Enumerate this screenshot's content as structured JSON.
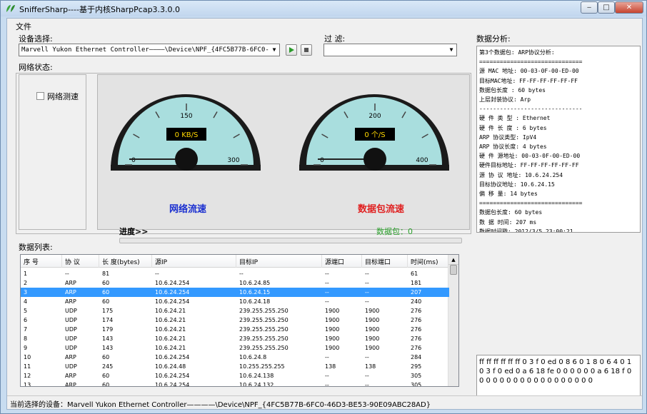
{
  "window": {
    "title": "SnifferSharp----基于内核SharpPcap3.3.0.0"
  },
  "menu": {
    "file": "文件"
  },
  "device": {
    "label": "设备选择:",
    "value": "Marvell Yukon Ethernet Controller————\\Device\\NPF_{4FC5B77B-6FC0-46"
  },
  "filter": {
    "label": "过 滤:",
    "value": ""
  },
  "network_status": {
    "label": "网络状态:",
    "speed_test_label": "网络测速",
    "speed_test_checked": false
  },
  "gauge_flow": {
    "caption": "网络流速",
    "readout": "0 KB/S",
    "ticks": [
      "0",
      "150",
      "300"
    ],
    "value": 0,
    "max": 300,
    "caption_color": "#1a2fd0"
  },
  "gauge_packets": {
    "caption": "数据包流速",
    "readout": "0 个/S",
    "ticks": [
      "0",
      "200",
      "400"
    ],
    "value": 0,
    "max": 400,
    "caption_color": "#e02020"
  },
  "progress": {
    "label": "进度>>",
    "packets_label": "数据包：0",
    "packets_color": "#2ca02c",
    "fraction": 0
  },
  "analysis": {
    "label": "数据分析:",
    "lines": [
      "第3个数据包: ARP协议分析:",
      "==============================",
      "源 MAC 地址: 00-03-0F-00-ED-00",
      "目标MAC地址: FF-FF-FF-FF-FF-FF",
      "数据包长度 : 60 bytes",
      "上层封装协议: Arp",
      "------------------------------",
      "硬 件 类 型 : Ethernet",
      "硬 件 长 度 : 6 bytes",
      "ARP 协议类型: IpV4",
      "ARP 协议长度: 4 bytes",
      "硬 件 源地址: 00-03-0F-00-ED-00",
      "硬件目标地址: FF-FF-FF-FF-FF-FF",
      "源 协 议 地址: 10.6.24.254",
      "目标协议地址: 10.6.24.15",
      "偏    移    量: 14 bytes",
      "==============================",
      "数据包长度: 60 bytes",
      "数 据 时间: 207 ms",
      "数据时间戳: 2012/3/5 23:00:21"
    ],
    "hex": "ff ff ff ff ff ff 0 3 f 0 ed 0 8 6 0 1 8 0 6 4 0 1 0 3 f 0 ed 0 a 6 18 fe 0 0 0 0 0 0 a 6 18 f 0 0 0 0 0 0 0 0 0 0 0 0 0 0 0 0 0 0"
  },
  "table": {
    "label": "数据列表:",
    "columns": [
      "序 号",
      "协 议",
      "长 度(bytes)",
      "源IP",
      "目标IP",
      "源端口",
      "目标端口",
      "时间(ms)"
    ],
    "rows": [
      [
        "1",
        "--",
        "81",
        "--",
        "--",
        "--",
        "--",
        "61"
      ],
      [
        "2",
        "ARP",
        "60",
        "10.6.24.254",
        "10.6.24.85",
        "--",
        "--",
        "181"
      ],
      [
        "3",
        "ARP",
        "60",
        "10.6.24.254",
        "10.6.24.15",
        "--",
        "--",
        "207"
      ],
      [
        "4",
        "ARP",
        "60",
        "10.6.24.254",
        "10.6.24.18",
        "--",
        "--",
        "240"
      ],
      [
        "5",
        "UDP",
        "175",
        "10.6.24.21",
        "239.255.255.250",
        "1900",
        "1900",
        "276"
      ],
      [
        "6",
        "UDP",
        "174",
        "10.6.24.21",
        "239.255.255.250",
        "1900",
        "1900",
        "276"
      ],
      [
        "7",
        "UDP",
        "179",
        "10.6.24.21",
        "239.255.255.250",
        "1900",
        "1900",
        "276"
      ],
      [
        "8",
        "UDP",
        "143",
        "10.6.24.21",
        "239.255.255.250",
        "1900",
        "1900",
        "276"
      ],
      [
        "9",
        "UDP",
        "143",
        "10.6.24.21",
        "239.255.255.250",
        "1900",
        "1900",
        "276"
      ],
      [
        "10",
        "ARP",
        "60",
        "10.6.24.254",
        "10.6.24.8",
        "--",
        "--",
        "284"
      ],
      [
        "11",
        "UDP",
        "245",
        "10.6.24.48",
        "10.255.255.255",
        "138",
        "138",
        "295"
      ],
      [
        "12",
        "ARP",
        "60",
        "10.6.24.254",
        "10.6.24.138",
        "--",
        "--",
        "305"
      ],
      [
        "13",
        "ARP",
        "60",
        "10.6.24.254",
        "10.6.24.132",
        "--",
        "--",
        "305"
      ]
    ],
    "selected_row": 2
  },
  "status": {
    "text": "当前选择的设备：Marvell Yukon Ethernet Controller————\\Device\\NPF_{4FC5B77B-6FC0-46D3-BE53-90E09ABC28AD}"
  }
}
